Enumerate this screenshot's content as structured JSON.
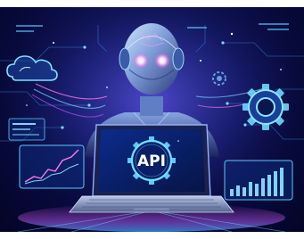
{
  "illustration": {
    "subject": "ai-robot-with-laptop",
    "laptop_screen_label": "API",
    "icons": [
      "cloud-icon",
      "gear-icon",
      "robot-head",
      "line-chart",
      "bar-chart"
    ],
    "colors": {
      "background": "#07093a",
      "glow_blue": "#3fa9ff",
      "glow_purple": "#c45cff",
      "accent_pink": "#ff4fd8",
      "screen": "#0b1f6b"
    }
  }
}
